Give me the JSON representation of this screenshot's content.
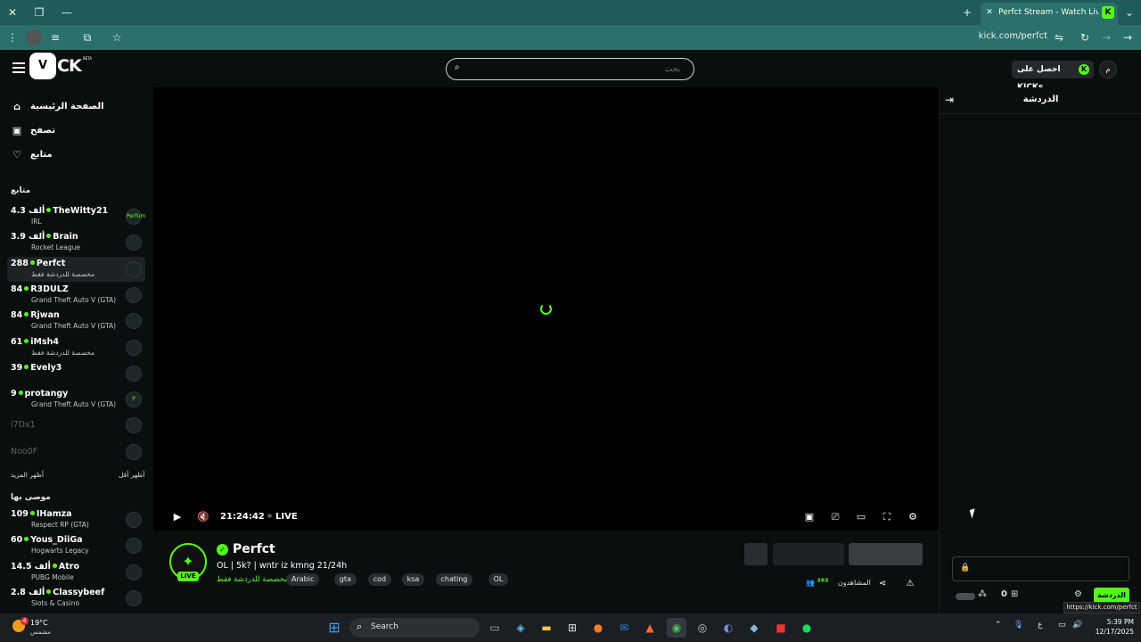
{
  "browser": {
    "tab_title": "Perfct Stream - Watch Live on K",
    "favicon_letter": "K",
    "url": "kick.com/perfct",
    "tooltip_url": "https://kick.com/perfct"
  },
  "header": {
    "logo_box": "V",
    "logo_text": "CK",
    "logo_beta": "BETA",
    "search_placeholder": "بحث",
    "kicks_button": "احصل على KICKs",
    "user_initial": "م"
  },
  "sidebar": {
    "nav": [
      {
        "label": "الصفحة الرئيسية",
        "icon": "home-icon"
      },
      {
        "label": "تصفح",
        "icon": "browse-icon"
      },
      {
        "label": "متابع",
        "icon": "heart-icon"
      }
    ],
    "following_title": "متابع",
    "following": [
      {
        "viewers": "4.3 ألف",
        "name": "TheWitty21",
        "category": "IRL",
        "avatar": "Perfum",
        "live": true
      },
      {
        "viewers": "3.9 ألف",
        "name": "Brain",
        "category": "Rocket League",
        "avatar": "",
        "live": true
      },
      {
        "viewers": "288",
        "name": "Perfct",
        "category": "مخصصة للدردشة فقط",
        "avatar": "",
        "live": true,
        "selected": true
      },
      {
        "viewers": "84",
        "name": "R3DULZ",
        "category": "Grand Theft Auto V (GTA)",
        "avatar": "",
        "live": true
      },
      {
        "viewers": "84",
        "name": "Rjwan",
        "category": "Grand Theft Auto V (GTA)",
        "avatar": "",
        "live": true
      },
      {
        "viewers": "61",
        "name": "iMsh4",
        "category": "مخصصة للدردشة فقط",
        "avatar": "",
        "live": true
      },
      {
        "viewers": "39",
        "name": "Evely3",
        "category": "",
        "avatar": "",
        "live": true
      },
      {
        "viewers": "9",
        "name": "protangy",
        "category": "Grand Theft Auto V (GTA)",
        "avatar": "P",
        "live": true
      },
      {
        "viewers": "",
        "name": "i7Dx1",
        "category": "",
        "avatar": "",
        "live": false
      },
      {
        "viewers": "",
        "name": "Noo0F",
        "category": "",
        "avatar": "",
        "live": false
      }
    ],
    "show_more": "أظهر المزيد",
    "show_less": "أظهر أقل",
    "recommended_title": "موصى بها",
    "recommended": [
      {
        "viewers": "109",
        "name": "IHamza",
        "category": "Respect RP (GTA)",
        "avatar": "",
        "live": true
      },
      {
        "viewers": "60",
        "name": "Yous_DiiGa",
        "category": "Hogwarts Legacy",
        "avatar": "",
        "live": true
      },
      {
        "viewers": "14.5 ألف",
        "name": "Atro",
        "category": "PUBG Mobile",
        "avatar": "",
        "live": true
      },
      {
        "viewers": "2.8 ألف",
        "name": "Classybeef",
        "category": "Slots & Casino",
        "avatar": "",
        "live": true
      }
    ]
  },
  "player": {
    "time": "21:24:42",
    "live_label": "LIVE"
  },
  "stream": {
    "name": "Perfct",
    "title": "OL | 5k? | wntr iz kmng 21/24h",
    "category": "مخصصة للدردشة فقط",
    "live_badge": "LIVE",
    "tags": [
      "Arabic",
      "gta",
      "cod",
      "ksa",
      "chating",
      "OL"
    ],
    "viewers_label": "المشاهدون",
    "viewers_value": "²⁶²"
  },
  "chat": {
    "title": "الدردشة",
    "send_label": "الدردشة",
    "kicks_count": "0"
  },
  "taskbar": {
    "temp": "19°C",
    "weather": "مشمس",
    "weather_badge": "4",
    "search": "Search",
    "lang": "ع",
    "time": "5:39 PM",
    "date": "12/17/2025"
  }
}
